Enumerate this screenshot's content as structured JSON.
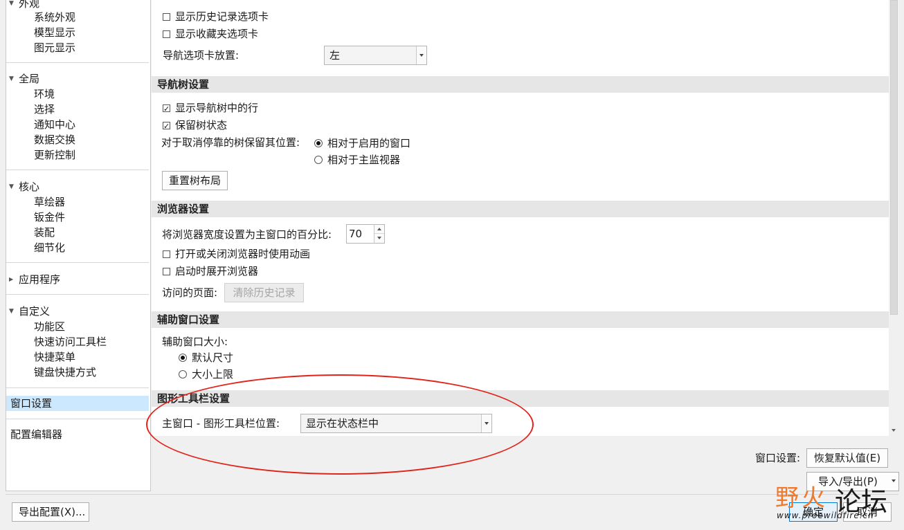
{
  "nav": {
    "appearance": {
      "title": "外观",
      "items": [
        "系统外观",
        "模型显示",
        "图元显示"
      ]
    },
    "global": {
      "title": "全局",
      "items": [
        "环境",
        "选择",
        "通知中心",
        "数据交换",
        "更新控制"
      ]
    },
    "core": {
      "title": "核心",
      "items": [
        "草绘器",
        "钣金件",
        "装配",
        "细节化"
      ]
    },
    "apps": {
      "title": "应用程序"
    },
    "customize": {
      "title": "自定义",
      "items": [
        "功能区",
        "快速访问工具栏",
        "快捷菜单",
        "键盘快捷方式"
      ]
    },
    "window_settings": "窗口设置",
    "config_editor": "配置编辑器"
  },
  "tabs_section": {
    "show_history_tab": "显示历史记录选项卡",
    "show_history_tab_checked": false,
    "show_favorites_tab": "显示收藏夹选项卡",
    "show_favorites_tab_checked": false,
    "nav_tab_position_label": "导航选项卡放置:",
    "nav_tab_position_value": "左"
  },
  "tree_section": {
    "title": "导航树设置",
    "show_rows": "显示导航树中的行",
    "show_rows_checked": true,
    "keep_state": "保留树状态",
    "keep_state_checked": true,
    "undock_label": "对于取消停靠的树保留其位置:",
    "radio_active_window": "相对于启用的窗口",
    "radio_main_monitor": "相对于主监视器",
    "selected": "相对于启用的窗口",
    "reset_button": "重置树布局"
  },
  "browser_section": {
    "title": "浏览器设置",
    "width_label": "将浏览器宽度设置为主窗口的百分比:",
    "width_value": "70",
    "animate": "打开或关闭浏览器时使用动画",
    "animate_checked": false,
    "expand_on_start": "启动时展开浏览器",
    "expand_on_start_checked": false,
    "visited_label": "访问的页面:",
    "clear_history_button": "清除历史记录"
  },
  "aux_section": {
    "title": "辅助窗口设置",
    "size_label": "辅助窗口大小:",
    "radio_default": "默认尺寸",
    "radio_max": "大小上限",
    "selected": "默认尺寸"
  },
  "graphics_section": {
    "title": "图形工具栏设置",
    "position_label": "主窗口 - 图形工具栏位置:",
    "position_value": "显示在状态栏中"
  },
  "footer": {
    "window_settings_label": "窗口设置:",
    "restore_defaults_button": "恢复默认值(E)",
    "import_export_button": "导入/导出(P)",
    "export_config_button": "导出配置(X)...",
    "ok_button": "确定",
    "cancel_button": "取消"
  },
  "watermark": {
    "line1": "野火",
    "line2": "论坛",
    "url": "www.proewildfire.cn"
  },
  "colors": {
    "annotation": "#e2231a",
    "selection": "#cce8ff",
    "section_header": "#e6e6e6"
  }
}
